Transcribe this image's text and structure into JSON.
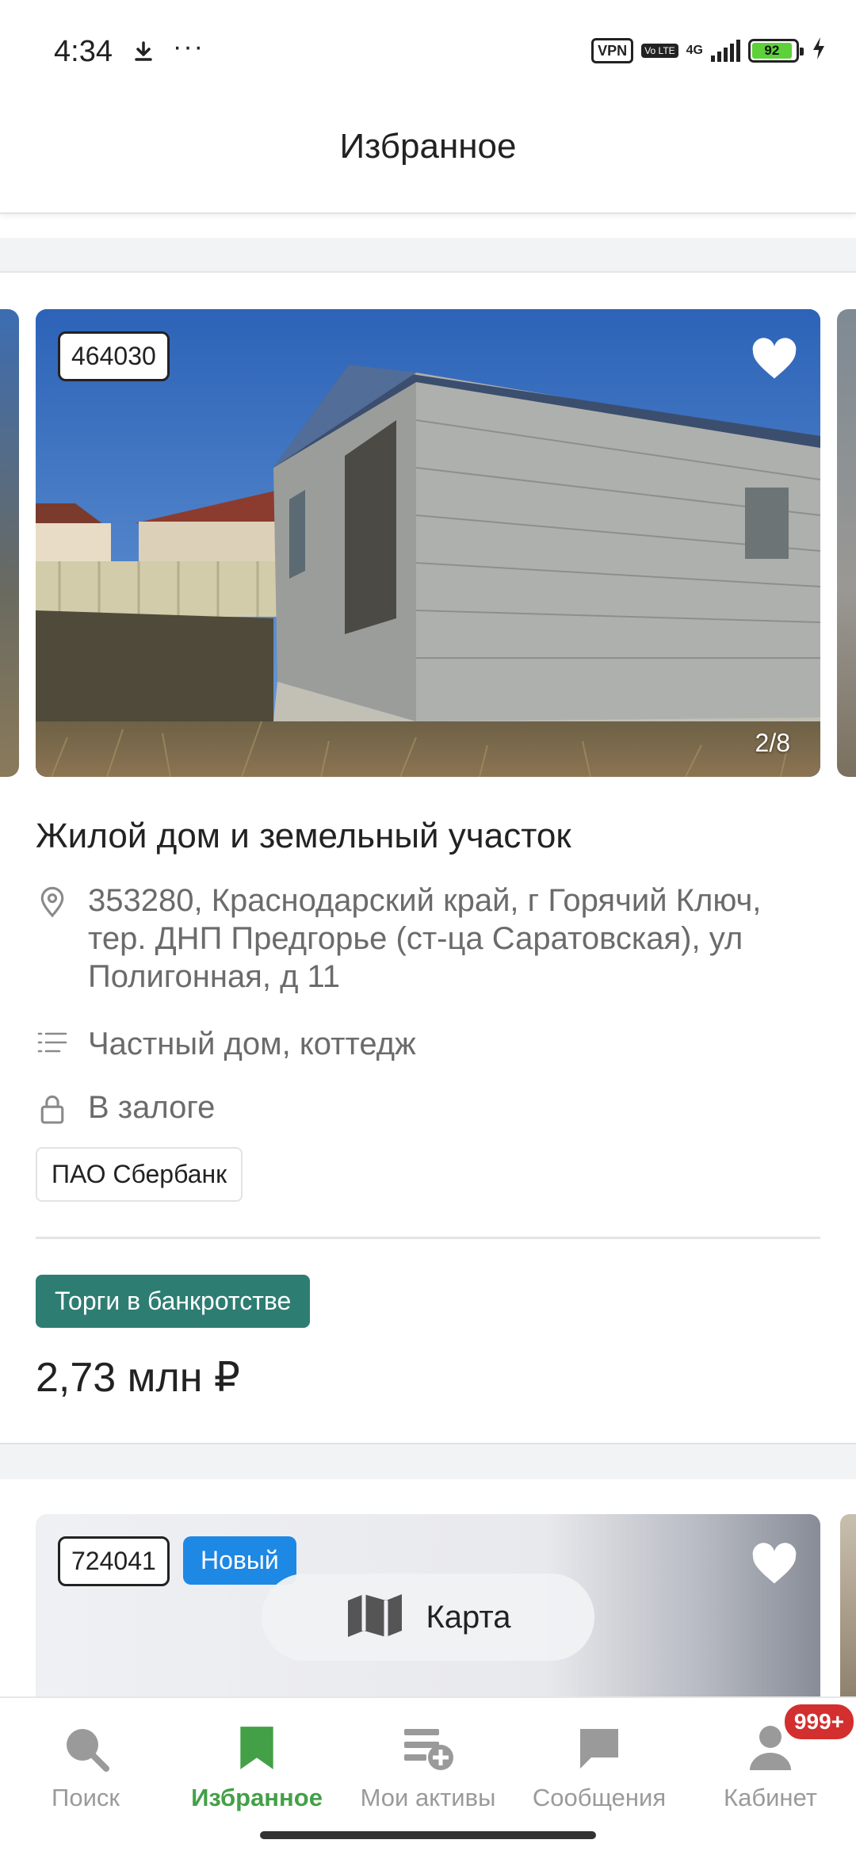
{
  "status_bar": {
    "time": "4:34",
    "more": "···",
    "vpn": "VPN",
    "volte": "Vo LTE",
    "network": "4G",
    "battery": "92"
  },
  "header": {
    "title": "Избранное"
  },
  "card1": {
    "lot_id": "464030",
    "photo_counter": "2/8",
    "title": "Жилой дом и земельный участок",
    "address": "353280, Краснодарский край, г Горячий Ключ, тер. ДНП Предгорье (ст-ца Саратовская), ул Полигонная, д 11",
    "category": "Частный дом, коттедж",
    "encumbrance": "В залоге",
    "bank": "ПАО Сбербанк",
    "auction_type": "Торги в банкротстве",
    "price": "2,73 млн ₽"
  },
  "card2": {
    "lot_id": "724041",
    "new_badge": "Новый",
    "map_label": "Карта"
  },
  "bottom_nav": {
    "items": [
      {
        "label": "Поиск",
        "icon": "search-icon"
      },
      {
        "label": "Избранное",
        "icon": "bookmark-icon"
      },
      {
        "label": "Мои активы",
        "icon": "assets-add-icon"
      },
      {
        "label": "Сообщения",
        "icon": "chat-icon"
      },
      {
        "label": "Кабинет",
        "icon": "person-icon"
      }
    ],
    "notification_count": "999+",
    "active_index": 1
  },
  "colors": {
    "accent_green": "#43a047",
    "auction_badge": "#2e7d72",
    "new_badge": "#1e88e5",
    "notification": "#d32f2f"
  }
}
